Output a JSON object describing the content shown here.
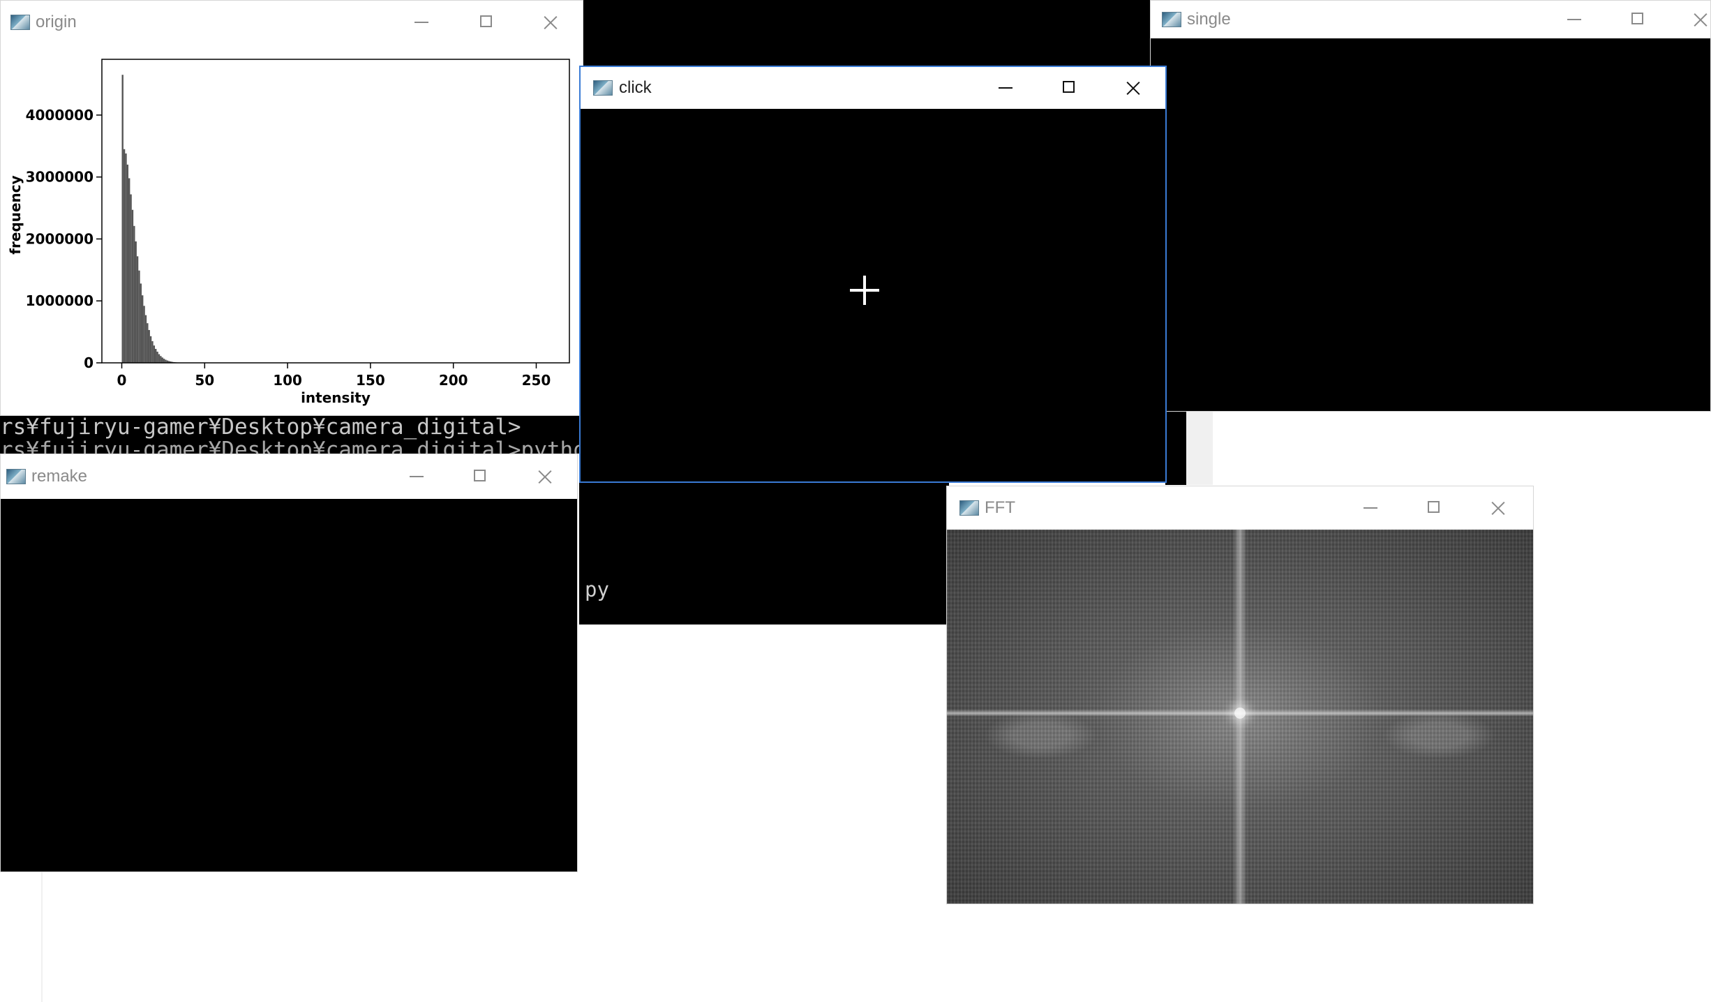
{
  "console": {
    "line1": "rs¥fujiryu-gamer¥Desktop¥camera_digital>",
    "line2": "rs¥fujiryu-gamer¥Desktop¥camera_digital>python aaaa.p",
    "py_fragment": "py"
  },
  "windows": {
    "origin": {
      "title": "origin"
    },
    "click": {
      "title": "click"
    },
    "single": {
      "title": "single"
    },
    "remake": {
      "title": "remake"
    },
    "fft": {
      "title": "FFT"
    }
  },
  "chart_data": {
    "type": "bar",
    "xlabel": "intensity",
    "ylabel": "frequency",
    "xlim": [
      -12,
      270
    ],
    "ylim": [
      0,
      4900000
    ],
    "xticks": [
      "0",
      "50",
      "100",
      "150",
      "200",
      "250"
    ],
    "yticks": [
      "0",
      "1000000",
      "2000000",
      "3000000",
      "4000000"
    ],
    "x": [
      0,
      1,
      2,
      3,
      4,
      5,
      6,
      7,
      8,
      9,
      10,
      11,
      12,
      13,
      14,
      15,
      16,
      17,
      18,
      19,
      20,
      21,
      22,
      23,
      24,
      25,
      26,
      27,
      28,
      29,
      30,
      31,
      32,
      33,
      34,
      35
    ],
    "values": [
      4650000,
      3450000,
      3380000,
      3200000,
      2980000,
      2720000,
      2470000,
      2210000,
      1960000,
      1720000,
      1490000,
      1280000,
      1090000,
      920000,
      770000,
      640000,
      530000,
      430000,
      350000,
      280000,
      225000,
      180000,
      140000,
      110000,
      86000,
      66000,
      50000,
      38000,
      29000,
      22000,
      16000,
      12000,
      9000,
      6500,
      4500,
      3000
    ],
    "bar_color": "#555555"
  },
  "colors": {
    "active_border": "#3a7bd5",
    "console_bg": "#000000"
  },
  "icons": [
    "app-icon",
    "minimize-icon",
    "maximize-icon",
    "close-icon",
    "crosshair-cursor-icon"
  ]
}
